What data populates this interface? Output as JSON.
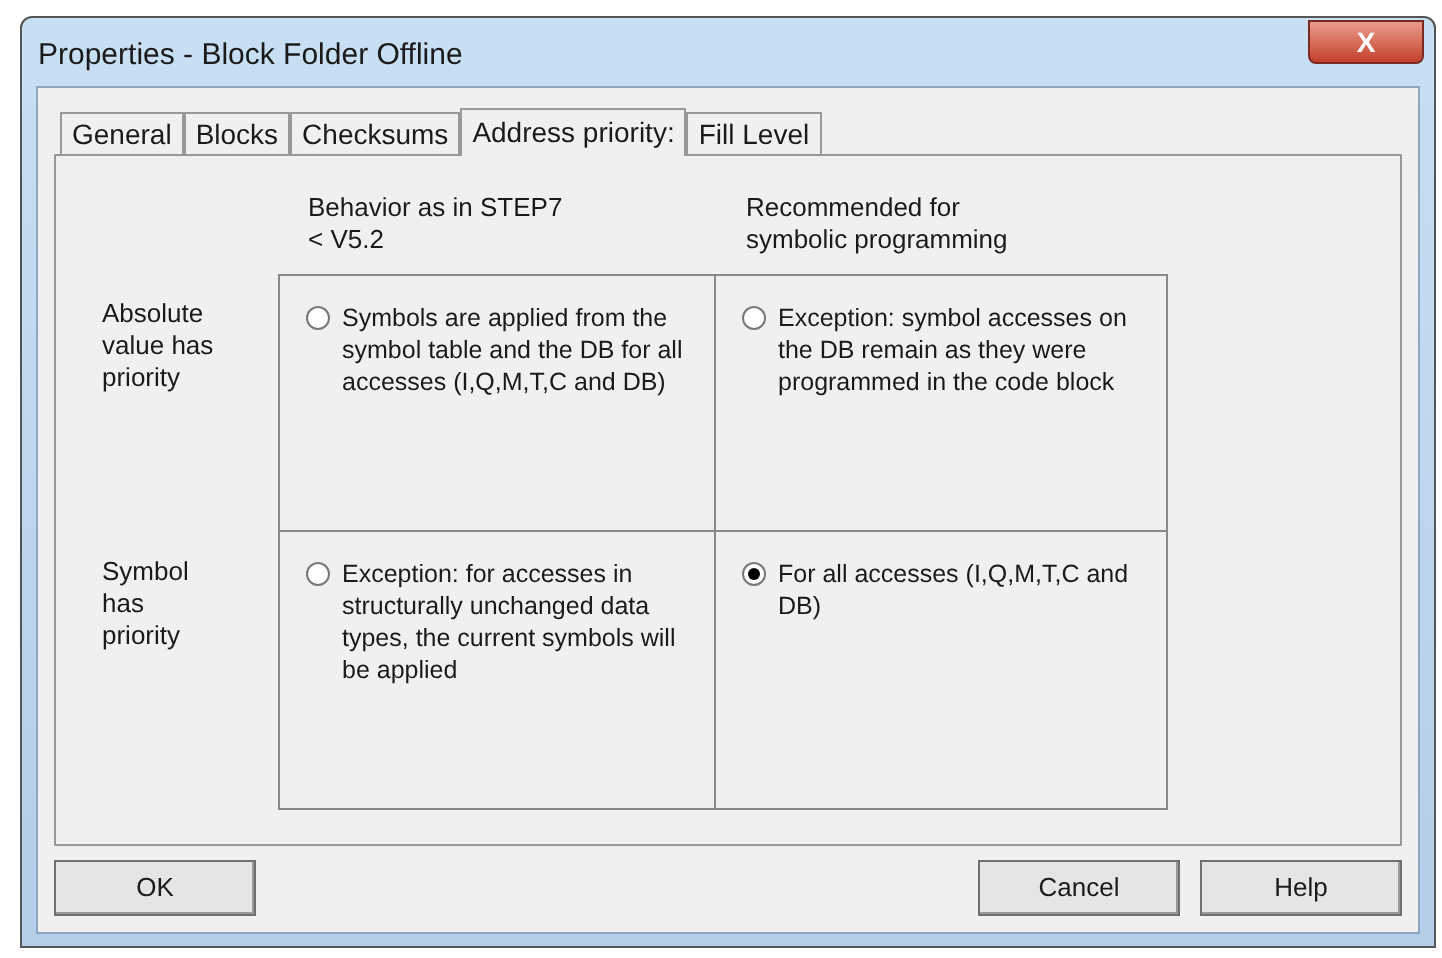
{
  "window": {
    "title": "Properties - Block Folder Offline",
    "close": "X"
  },
  "tabs": [
    {
      "label": "General",
      "selected": false
    },
    {
      "label": "Blocks",
      "selected": false
    },
    {
      "label": "Checksums",
      "selected": false
    },
    {
      "label": "Address priority:",
      "selected": true
    },
    {
      "label": "Fill Level",
      "selected": false
    }
  ],
  "columns": [
    "Behavior as in STEP7 < V5.2",
    "Recommended for symbolic programming"
  ],
  "rows": [
    {
      "label": "Absolute value has priority",
      "options": [
        {
          "text": "Symbols are applied from the symbol table and the DB for all accesses (I,Q,M,T,C and DB)",
          "selected": false
        },
        {
          "text": "Exception: symbol accesses on the DB remain as they were programmed in the code block",
          "selected": false
        }
      ]
    },
    {
      "label": "Symbol has priority",
      "options": [
        {
          "text": "Exception: for accesses in structurally unchanged data types, the current symbols will be applied",
          "selected": false
        },
        {
          "text": "For all accesses (I,Q,M,T,C and DB)",
          "selected": true
        }
      ]
    }
  ],
  "buttons": {
    "ok": "OK",
    "cancel": "Cancel",
    "help": "Help"
  }
}
